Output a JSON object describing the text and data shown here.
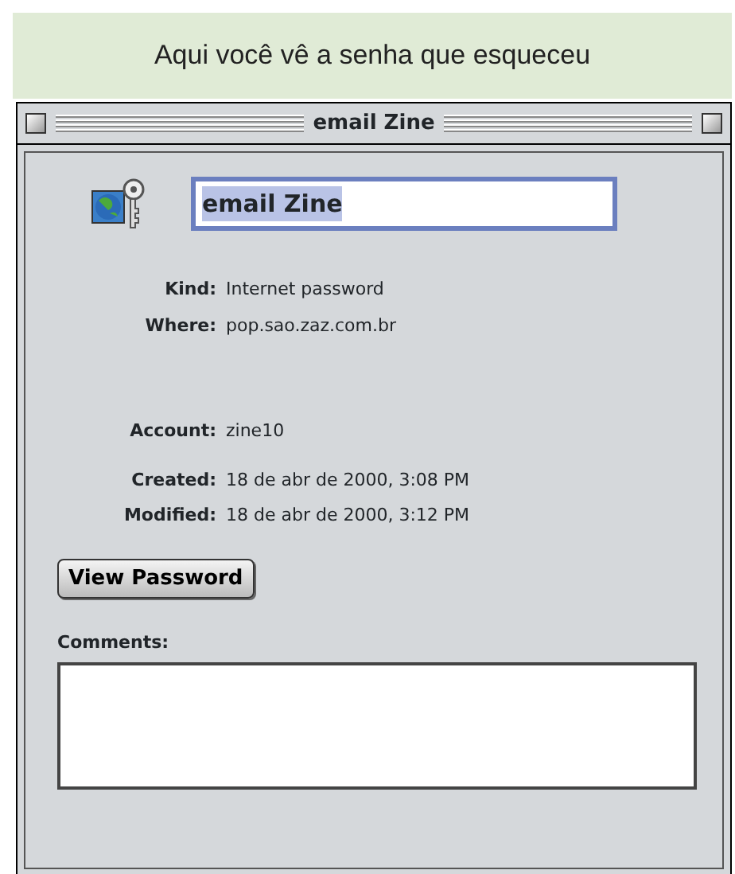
{
  "caption": "Aqui você vê a senha que esqueceu",
  "window": {
    "title": "email Zine"
  },
  "name_field": {
    "value": "email Zine",
    "focused": true,
    "text_selected": true
  },
  "field_groups": [
    [
      {
        "label": "Kind:",
        "value": "Internet password"
      },
      {
        "label": "Where:",
        "value": "pop.sao.zaz.com.br"
      }
    ],
    [
      {
        "label": "Account:",
        "value": "zine10"
      }
    ],
    [
      {
        "label": "Created:",
        "value": "18 de abr de 2000, 3:08 PM"
      },
      {
        "label": "Modified:",
        "value": "18 de abr de 2000, 3:12 PM"
      }
    ]
  ],
  "button": "View Password",
  "comments": {
    "label": "Comments:"
  }
}
